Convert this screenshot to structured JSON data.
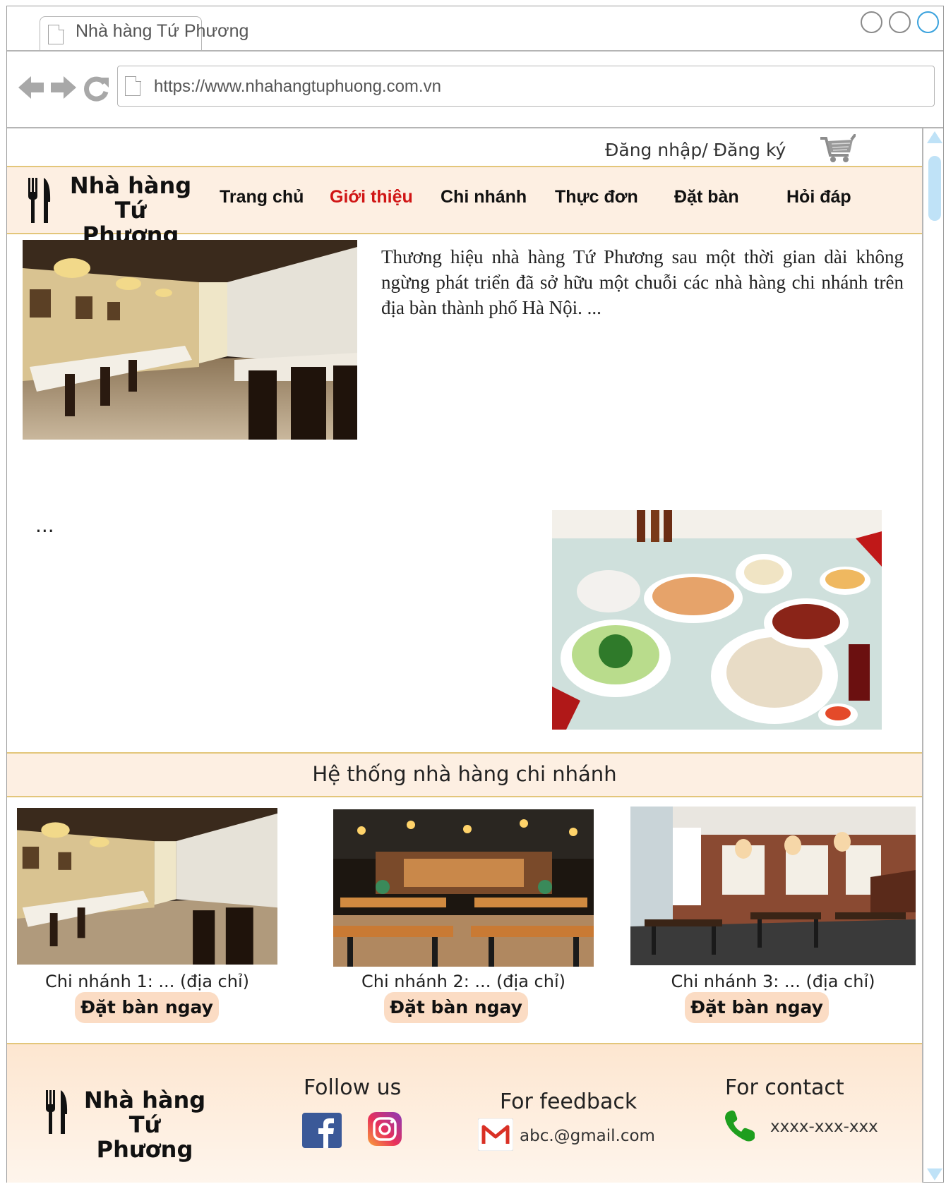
{
  "browser": {
    "tab_title": "Nhà hàng Tứ Phương",
    "url": "https://www.nhahangtuphuong.com.vn",
    "back_icon": "arrow-left-icon",
    "forward_icon": "arrow-right-icon",
    "reload_icon": "reload-icon"
  },
  "topbar": {
    "login_label": "Đăng nhập/ Đăng ký",
    "cart_icon": "shopping-cart-icon"
  },
  "brand": {
    "line1": "Nhà hàng",
    "line2": "Tứ Phương",
    "icon": "fork-knife-icon"
  },
  "nav": {
    "items": [
      {
        "label": "Trang chủ"
      },
      {
        "label": "Giới thiệu",
        "active": true
      },
      {
        "label": "Chi nhánh"
      },
      {
        "label": "Thực đơn"
      },
      {
        "label": "Đặt bàn"
      },
      {
        "label": "Hỏi đáp"
      }
    ]
  },
  "intro": {
    "text": "Thương hiệu nhà hàng Tứ Phương sau một thời gian dài không ngừng phát triển đã sở hữu một chuỗi các nhà hàng chi nhánh trên địa bàn thành phố Hà Nội. ...",
    "more": "..."
  },
  "branches": {
    "title": "Hệ thống nhà hàng chi nhánh",
    "items": [
      {
        "caption": "Chi nhánh 1: ... (địa chỉ)",
        "button": "Đặt bàn ngay"
      },
      {
        "caption": "Chi nhánh 2: ... (địa chỉ)",
        "button": "Đặt bàn ngay"
      },
      {
        "caption": "Chi nhánh 3: ... (địa chỉ)",
        "button": "Đặt bàn ngay"
      }
    ]
  },
  "footer": {
    "follow_title": "Follow us",
    "feedback_title": "For feedback",
    "email": "abc.@gmail.com",
    "contact_title": "For contact",
    "phone": "xxxx-xxx-xxx",
    "colors": {
      "facebook": "#3b5998",
      "phone": "#1e9e1e",
      "gmail": "#d93025"
    }
  },
  "colors": {
    "header_bg": "#fdefe2",
    "header_border": "#e3c67a",
    "active_nav": "#d01515",
    "button_bg": "#fbdcc4",
    "scroll": "#bfe2f7"
  }
}
